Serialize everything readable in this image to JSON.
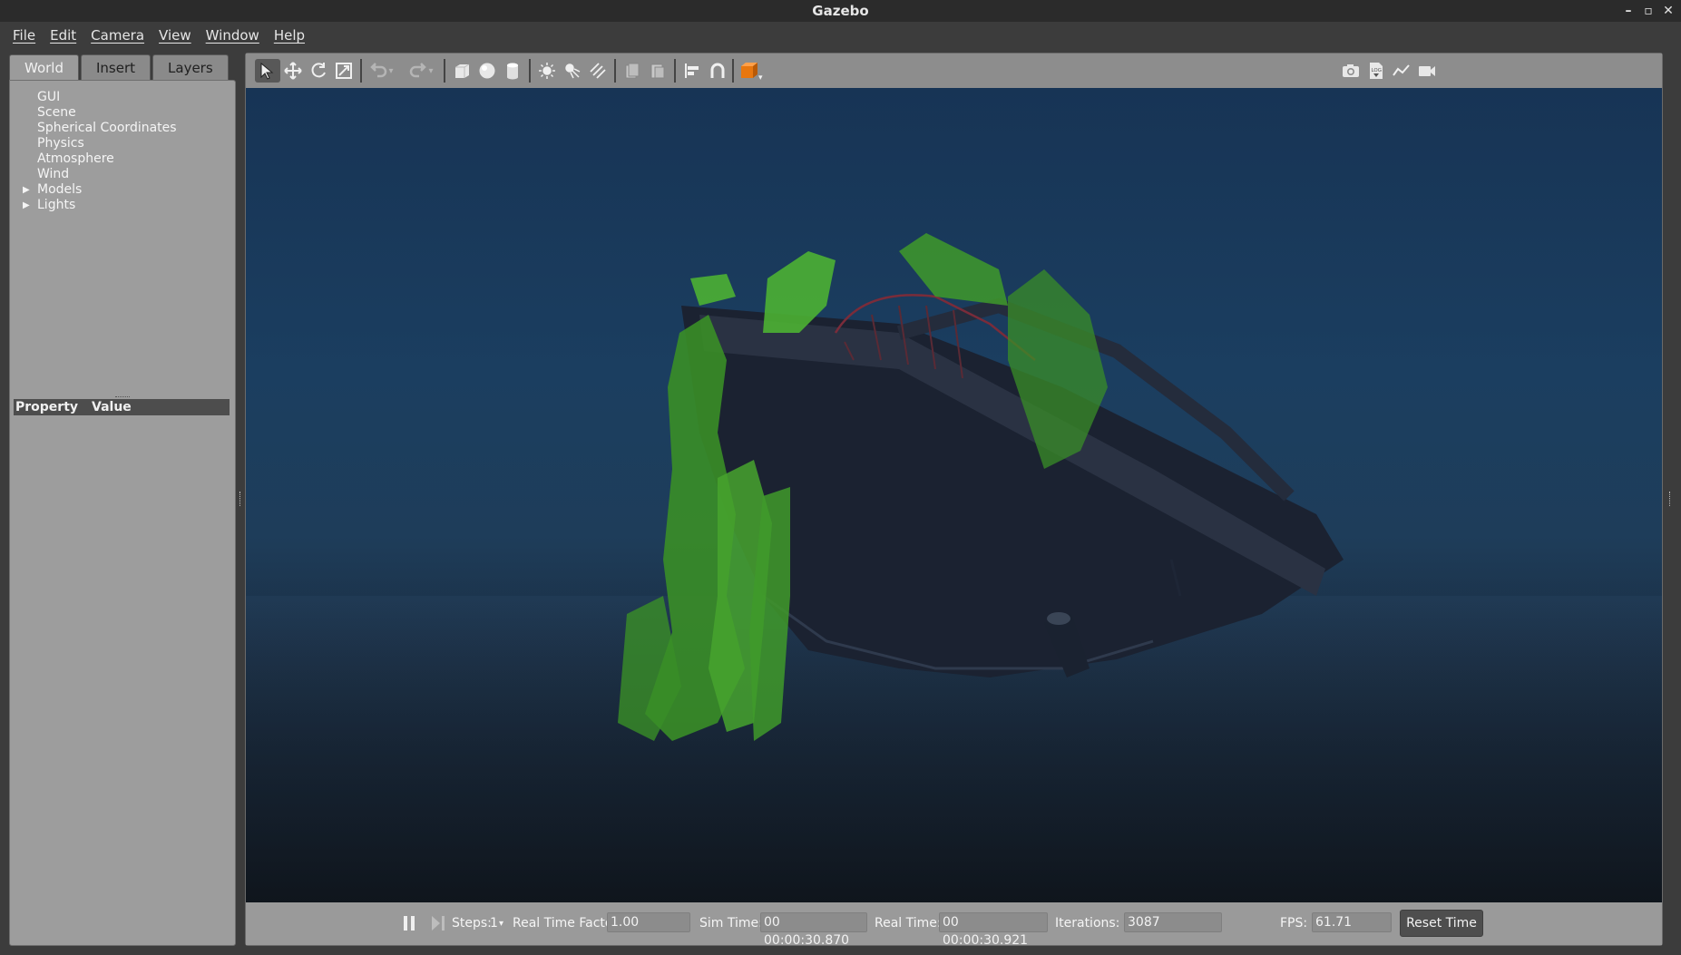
{
  "window": {
    "title": "Gazebo",
    "controls": [
      "–",
      "▫",
      "✕"
    ]
  },
  "menu": [
    "File",
    "Edit",
    "Camera",
    "View",
    "Window",
    "Help"
  ],
  "left_panel": {
    "tabs": [
      "World",
      "Insert",
      "Layers"
    ],
    "active_tab": "World",
    "tree": [
      {
        "label": "GUI",
        "expandable": false
      },
      {
        "label": "Scene",
        "expandable": false
      },
      {
        "label": "Spherical Coordinates",
        "expandable": false
      },
      {
        "label": "Physics",
        "expandable": false
      },
      {
        "label": "Atmosphere",
        "expandable": false
      },
      {
        "label": "Wind",
        "expandable": false
      },
      {
        "label": "Models",
        "expandable": true
      },
      {
        "label": "Lights",
        "expandable": true
      }
    ],
    "property_header": {
      "property": "Property",
      "value": "Value"
    }
  },
  "toolbar": {
    "tools": [
      "select-icon",
      "translate-icon",
      "rotate-icon",
      "scale-icon",
      "undo-icon",
      "redo-icon",
      "box-icon",
      "sphere-icon",
      "cylinder-icon",
      "point-light-icon",
      "spot-light-icon",
      "directional-light-icon",
      "copy-icon",
      "paste-icon",
      "align-icon",
      "snap-icon",
      "view-angle-icon"
    ],
    "right_tools": [
      "screenshot-icon",
      "log-icon",
      "plot-icon",
      "record-video-icon"
    ]
  },
  "status": {
    "steps_label": "Steps:",
    "steps_value": "1",
    "rtf_label": "Real Time Factor:",
    "rtf_value": "1.00",
    "sim_time_label": "Sim Time:",
    "sim_time_value": "00 00:00:30.870",
    "real_time_label": "Real Time:",
    "real_time_value": "00 00:00:30.921",
    "iterations_label": "Iterations:",
    "iterations_value": "3087",
    "fps_label": "FPS:",
    "fps_value": "61.71",
    "reset_label": "Reset Time"
  },
  "colors": {
    "water_top": "#173455",
    "seabed": "#121922",
    "algae": "#3f9a2a",
    "hull": "#1a2130"
  }
}
